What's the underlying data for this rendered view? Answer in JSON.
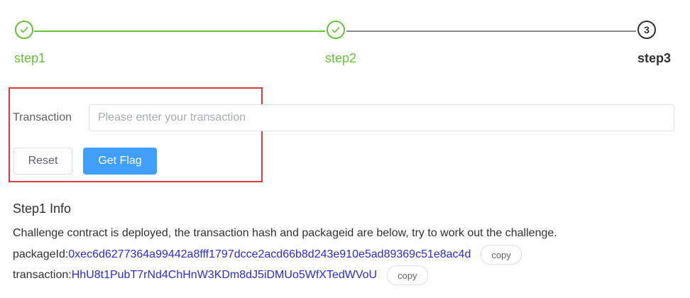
{
  "steps": [
    {
      "title": "step1",
      "status": "done",
      "icon": "check-icon"
    },
    {
      "title": "step2",
      "status": "done",
      "icon": "check-icon"
    },
    {
      "title": "step3",
      "status": "active",
      "number": "3"
    }
  ],
  "form": {
    "transaction_label": "Transaction",
    "transaction_placeholder": "Please enter your transaction",
    "transaction_value": "",
    "reset_label": "Reset",
    "get_flag_label": "Get Flag"
  },
  "info": {
    "title": "Step1 Info",
    "description": "Challenge contract is deployed, the transaction hash and packageid are below, try to work out the challenge.",
    "package_label": "packageId: ",
    "package_id": "0xec6d6277364a99442a8fff1797dcce2acd66b8d243e910e5ad89369c51e8ac4d",
    "transaction_label": "transaction:",
    "transaction_hash": "HhU8t1PubT7rNd4ChHnW3KDm8dJ5iDMUo5WfXTedWVoU",
    "copy_label": "copy"
  },
  "colors": {
    "success": "#67c23a",
    "primary": "#409eff",
    "highlight_frame": "#e0393e",
    "link": "#2b2bd6"
  }
}
